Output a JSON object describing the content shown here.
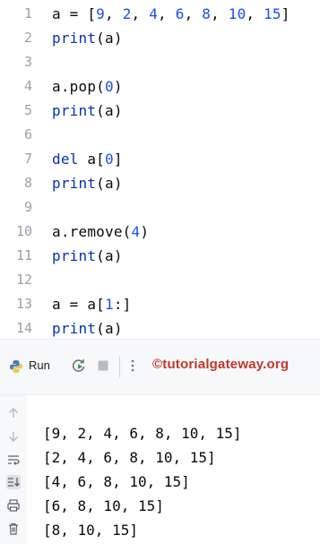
{
  "editor": {
    "line_numbers": [
      "1",
      "2",
      "3",
      "4",
      "5",
      "6",
      "7",
      "8",
      "9",
      "10",
      "11",
      "12",
      "13",
      "14"
    ],
    "lines": [
      [
        {
          "t": "a = [",
          "c": ""
        },
        {
          "t": "9",
          "c": "num"
        },
        {
          "t": ", ",
          "c": ""
        },
        {
          "t": "2",
          "c": "num"
        },
        {
          "t": ", ",
          "c": ""
        },
        {
          "t": "4",
          "c": "num"
        },
        {
          "t": ", ",
          "c": ""
        },
        {
          "t": "6",
          "c": "num"
        },
        {
          "t": ", ",
          "c": ""
        },
        {
          "t": "8",
          "c": "num"
        },
        {
          "t": ", ",
          "c": ""
        },
        {
          "t": "10",
          "c": "num"
        },
        {
          "t": ", ",
          "c": ""
        },
        {
          "t": "15",
          "c": "num"
        },
        {
          "t": "]",
          "c": ""
        }
      ],
      [
        {
          "t": "print",
          "c": "kw"
        },
        {
          "t": "(a)",
          "c": ""
        }
      ],
      [],
      [
        {
          "t": "a.pop(",
          "c": ""
        },
        {
          "t": "0",
          "c": "num"
        },
        {
          "t": ")",
          "c": ""
        }
      ],
      [
        {
          "t": "print",
          "c": "kw"
        },
        {
          "t": "(a)",
          "c": ""
        }
      ],
      [],
      [
        {
          "t": "del",
          "c": "kw"
        },
        {
          "t": " a[",
          "c": ""
        },
        {
          "t": "0",
          "c": "num"
        },
        {
          "t": "]",
          "c": ""
        }
      ],
      [
        {
          "t": "print",
          "c": "kw"
        },
        {
          "t": "(a)",
          "c": ""
        }
      ],
      [],
      [
        {
          "t": "a.remove(",
          "c": ""
        },
        {
          "t": "4",
          "c": "num"
        },
        {
          "t": ")",
          "c": ""
        }
      ],
      [
        {
          "t": "print",
          "c": "kw"
        },
        {
          "t": "(a)",
          "c": ""
        }
      ],
      [],
      [
        {
          "t": "a = a[",
          "c": ""
        },
        {
          "t": "1",
          "c": "num"
        },
        {
          "t": ":]",
          "c": ""
        }
      ],
      [
        {
          "t": "print",
          "c": "kw"
        },
        {
          "t": "(a)",
          "c": ""
        }
      ]
    ]
  },
  "toolbar": {
    "run_label": "Run",
    "brand": "©tutorialgateway.org"
  },
  "output": {
    "lines": [
      "[9, 2, 4, 6, 8, 10, 15]",
      "[2, 4, 6, 8, 10, 15]",
      "[4, 6, 8, 10, 15]",
      "[6, 8, 10, 15]",
      "[8, 10, 15]"
    ]
  },
  "colors": {
    "keyword": "#0033b3",
    "number": "#1750eb",
    "brand": "#c0392b"
  }
}
